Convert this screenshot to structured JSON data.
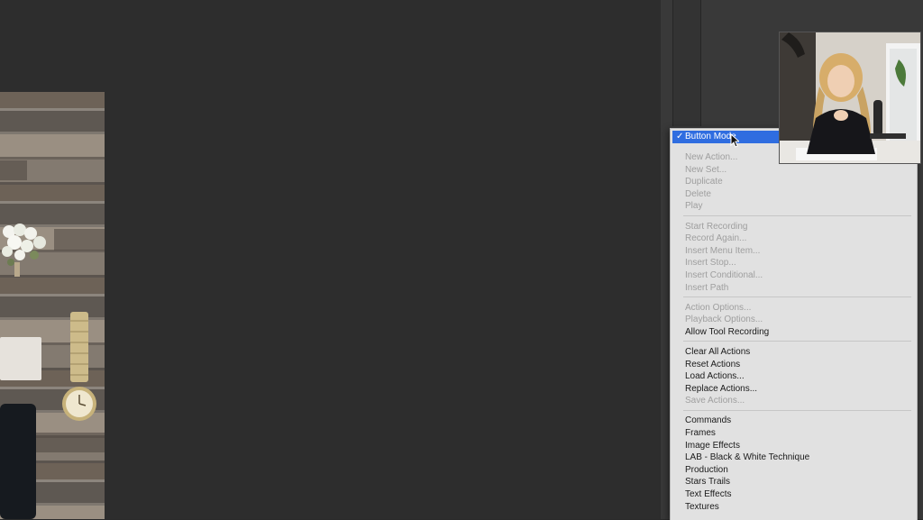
{
  "menu": {
    "selected_item": "Button Mode",
    "groups": [
      [
        {
          "label": "New Action...",
          "enabled": false
        },
        {
          "label": "New Set...",
          "enabled": false
        },
        {
          "label": "Duplicate",
          "enabled": false
        },
        {
          "label": "Delete",
          "enabled": false
        },
        {
          "label": "Play",
          "enabled": false
        }
      ],
      [
        {
          "label": "Start Recording",
          "enabled": false
        },
        {
          "label": "Record Again...",
          "enabled": false
        },
        {
          "label": "Insert Menu Item...",
          "enabled": false
        },
        {
          "label": "Insert Stop...",
          "enabled": false
        },
        {
          "label": "Insert Conditional...",
          "enabled": false
        },
        {
          "label": "Insert Path",
          "enabled": false
        }
      ],
      [
        {
          "label": "Action Options...",
          "enabled": false
        },
        {
          "label": "Playback Options...",
          "enabled": false
        },
        {
          "label": "Allow Tool Recording",
          "enabled": true
        }
      ],
      [
        {
          "label": "Clear All Actions",
          "enabled": true
        },
        {
          "label": "Reset Actions",
          "enabled": true
        },
        {
          "label": "Load Actions...",
          "enabled": true
        },
        {
          "label": "Replace Actions...",
          "enabled": true
        },
        {
          "label": "Save Actions...",
          "enabled": false
        }
      ],
      [
        {
          "label": "Commands",
          "enabled": true
        },
        {
          "label": "Frames",
          "enabled": true
        },
        {
          "label": "Image Effects",
          "enabled": true
        },
        {
          "label": "LAB - Black & White Technique",
          "enabled": true
        },
        {
          "label": "Production",
          "enabled": true
        },
        {
          "label": "Stars Trails",
          "enabled": true
        },
        {
          "label": "Text Effects",
          "enabled": true
        },
        {
          "label": "Textures",
          "enabled": true
        }
      ]
    ]
  },
  "icons": {
    "check": "checkmark-icon",
    "cursor": "mouse-pointer-icon"
  },
  "colors": {
    "highlight": "#2f6de0",
    "menu_bg": "#e1e1e1",
    "canvas_bg": "#2d2d2d"
  }
}
